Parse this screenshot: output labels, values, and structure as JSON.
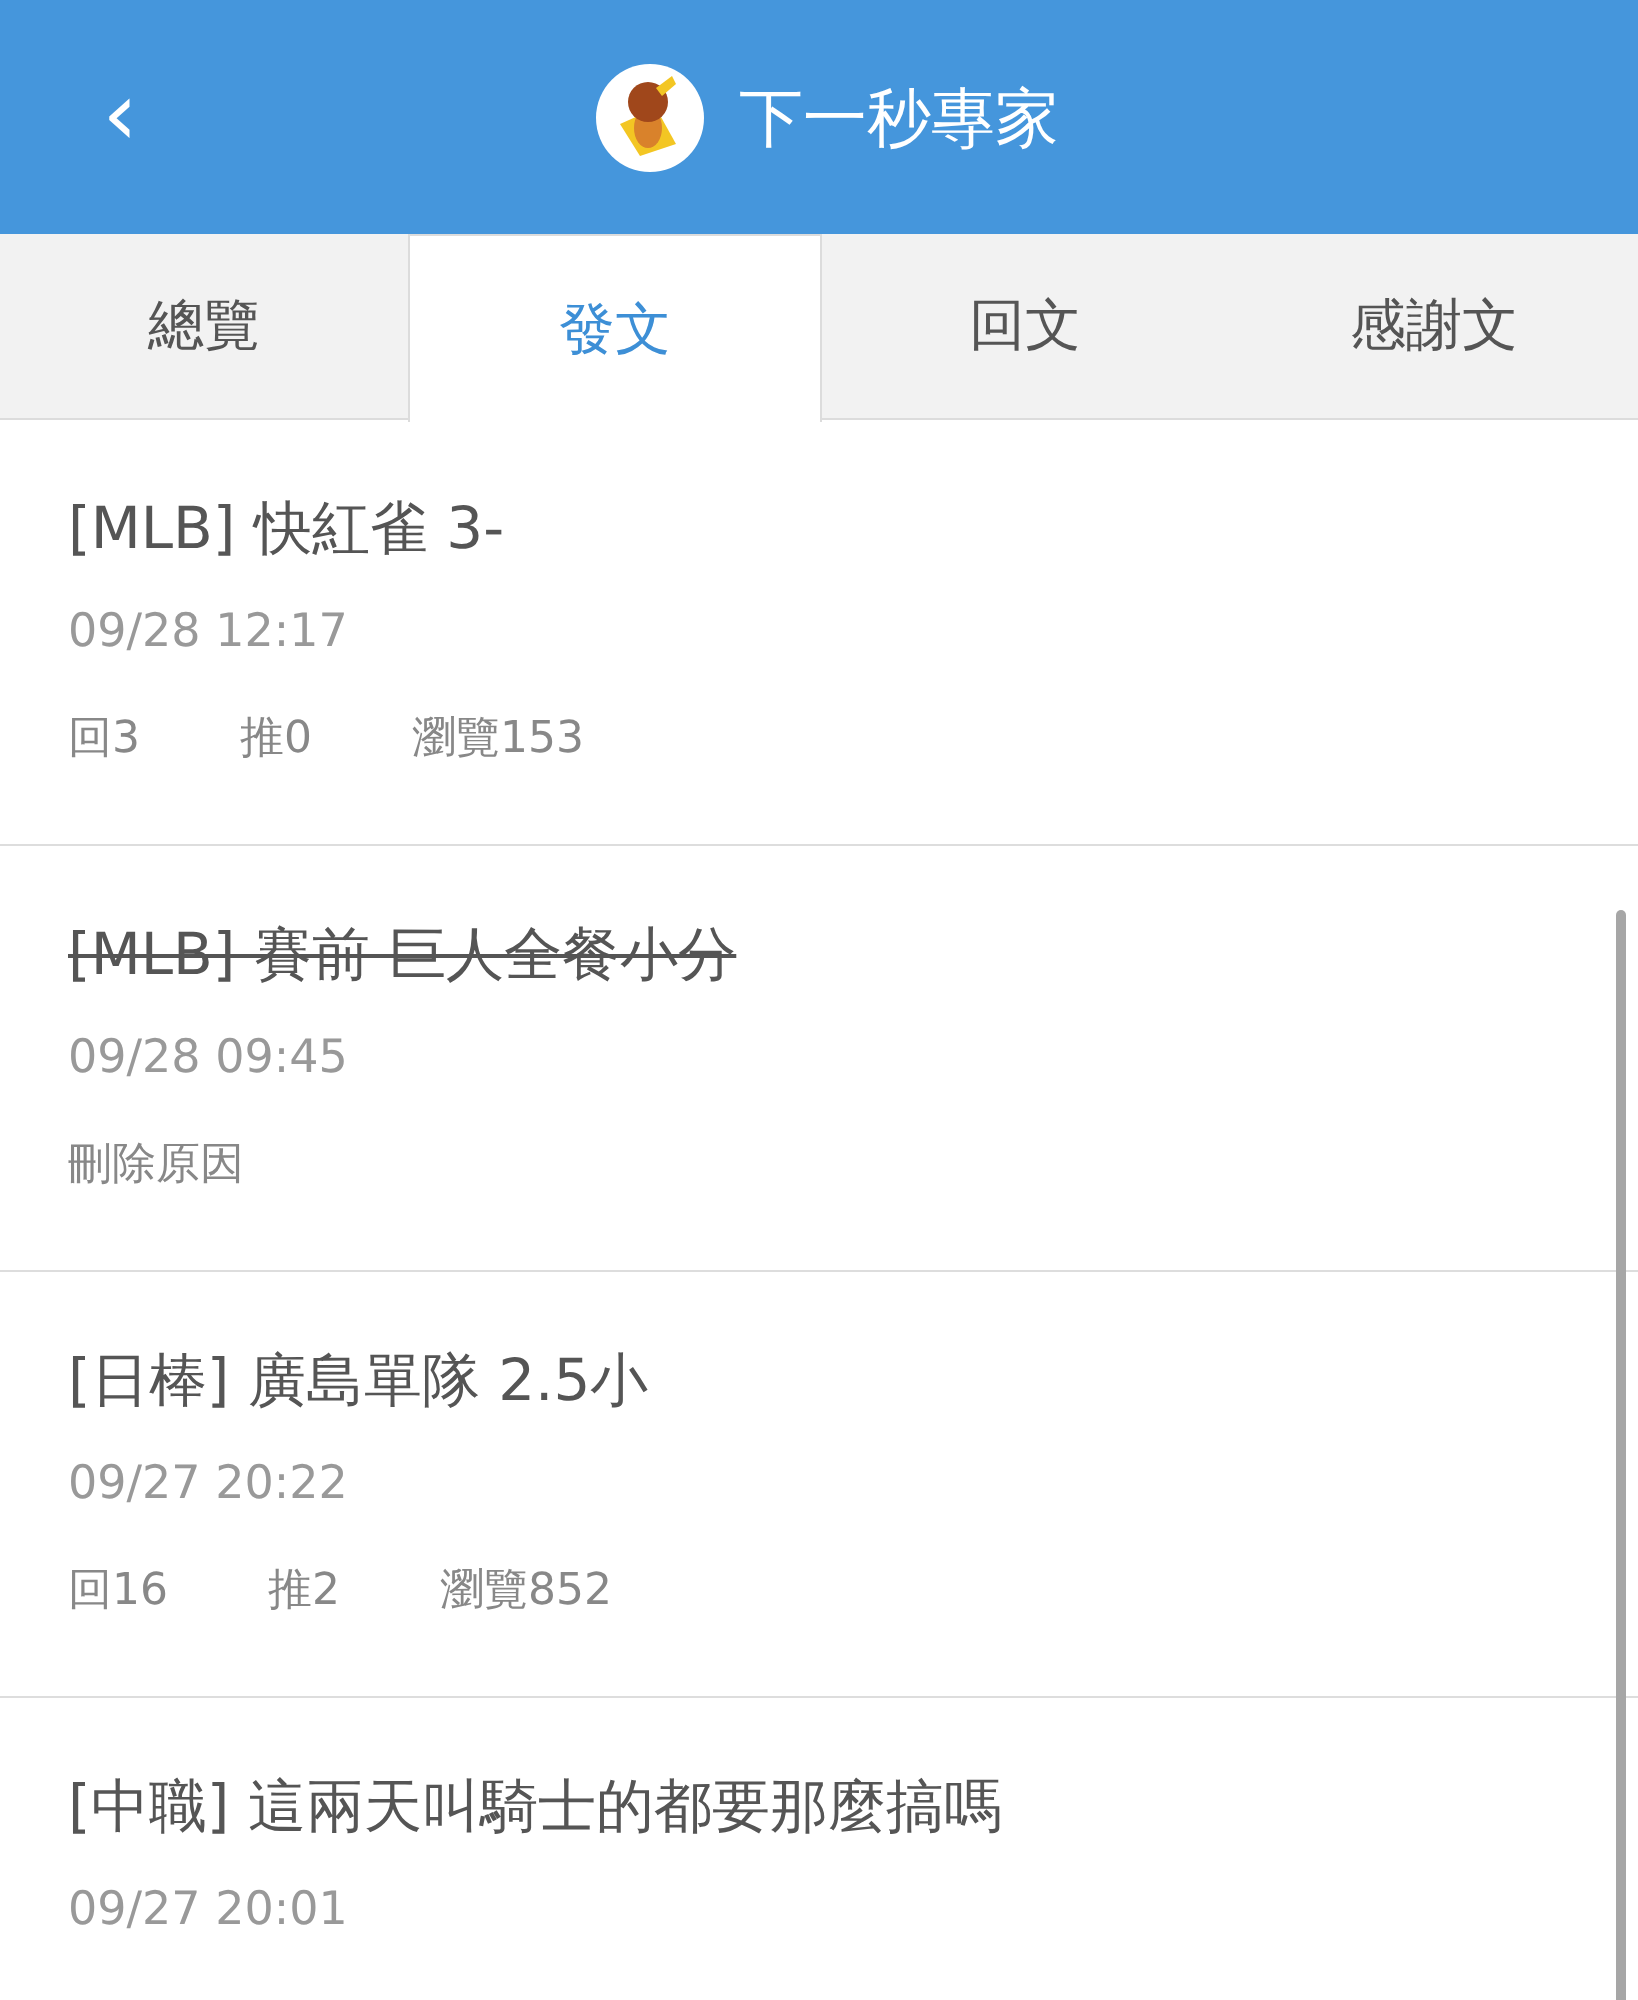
{
  "header": {
    "back": "‹",
    "title": "下一秒專家"
  },
  "tabs": [
    {
      "label": "總覽",
      "selected": false
    },
    {
      "label": "發文",
      "selected": true
    },
    {
      "label": "回文",
      "selected": false
    },
    {
      "label": "感謝文",
      "selected": false
    }
  ],
  "posts": [
    {
      "kind": "normal",
      "title": "[MLB] 快紅雀 3-",
      "time": "09/28 12:17",
      "stats": [
        "回3",
        "推0",
        "瀏覽153"
      ]
    },
    {
      "kind": "deleted",
      "title": "[MLB] 賽前 巨人全餐小分",
      "time": "09/28 09:45",
      "note": "刪除原因"
    },
    {
      "kind": "normal",
      "title": "[日棒] 廣島單隊 2.5小",
      "time": "09/27 20:22",
      "stats": [
        "回16",
        "推2",
        "瀏覽852"
      ]
    },
    {
      "kind": "normal",
      "title": "[中職] 這兩天叫騎士的都要那麼搞嗎",
      "time": "09/27 20:01"
    }
  ]
}
